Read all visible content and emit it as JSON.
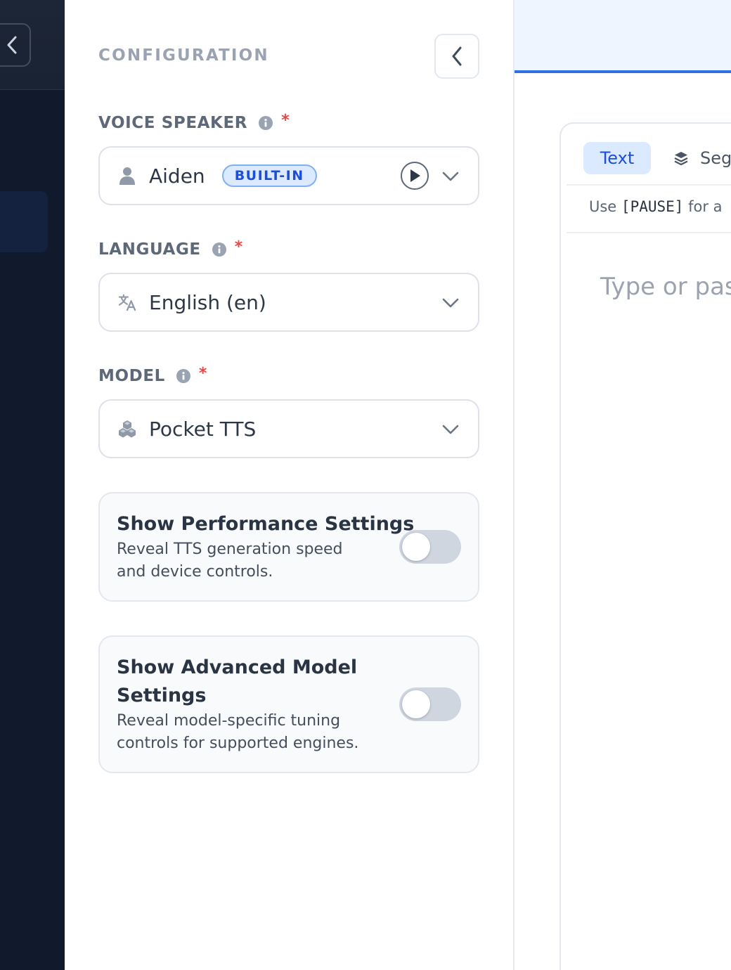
{
  "config": {
    "title": "CONFIGURATION",
    "voice_speaker": {
      "label": "VOICE SPEAKER",
      "required_mark": "*",
      "value": "Aiden",
      "badge": "BUILT-IN"
    },
    "language": {
      "label": "LANGUAGE",
      "required_mark": "*",
      "value": "English (en)"
    },
    "model": {
      "label": "MODEL",
      "required_mark": "*",
      "value": "Pocket TTS"
    },
    "performance_toggle": {
      "title": "Show Performance Settings",
      "description": "Reveal TTS generation speed and device controls.",
      "enabled": false
    },
    "advanced_toggle": {
      "title": "Show Advanced Model Settings",
      "description": "Reveal model-specific tuning controls for supported engines.",
      "enabled": false
    }
  },
  "editor": {
    "tabs": [
      {
        "label": "Text",
        "active": true
      },
      {
        "label": "Seg",
        "active": false
      }
    ],
    "hint_prefix": "Use",
    "hint_code": "[PAUSE]",
    "hint_suffix": "for a",
    "placeholder": "Type or pas"
  },
  "colors": {
    "accent": "#2f6fe4",
    "badge_text": "#1d4ed8",
    "required": "#ef4444",
    "sidebar": "#111a2c"
  }
}
